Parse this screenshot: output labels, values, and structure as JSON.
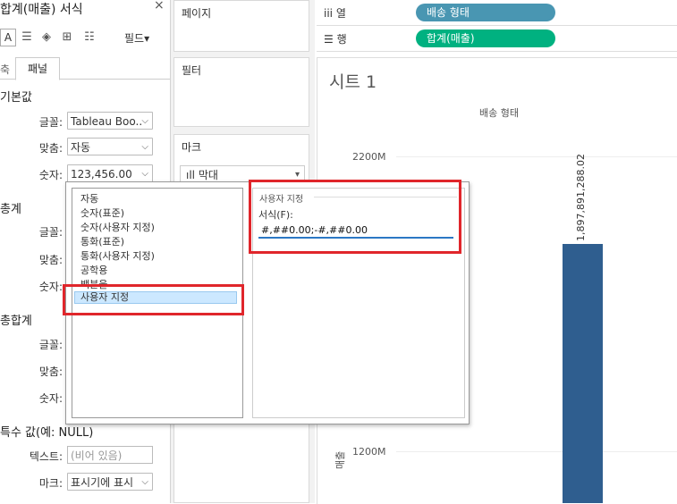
{
  "format_pane": {
    "title": "합계(매출) 서식",
    "close_glyph": "×",
    "fields_button": "필드▾",
    "tabs": {
      "inactive": "축",
      "active": "패널"
    },
    "sections": {
      "default": {
        "title": "기본값",
        "font_label": "글꼴:",
        "font_value": "Tableau Boo..",
        "align_label": "맞춤:",
        "align_value": "자동",
        "number_label": "숫자:",
        "number_value": "123,456.00"
      },
      "totals": {
        "title": "총계",
        "font_label": "글꼴:",
        "align_label": "맞춤:",
        "number_label": "숫자:"
      },
      "grand_totals": {
        "title": "총합계",
        "font_label": "글꼴:",
        "align_label": "맞춤:",
        "number_label": "숫자:"
      },
      "special": {
        "title": "특수 값(예: NULL)",
        "text_label": "텍스트:",
        "text_placeholder": "(비어 있음)",
        "marks_label": "마크:",
        "marks_value": "표시기에 표시"
      }
    }
  },
  "cards": {
    "pages": "페이지",
    "filters": "필터",
    "marks": "마크",
    "mark_type": "막대"
  },
  "shelves": {
    "columns": {
      "label": "열",
      "pill": "배송 형태",
      "color": "#4996b2"
    },
    "rows": {
      "label": "행",
      "pill": "합계(매출)",
      "color": "#00b180"
    }
  },
  "view": {
    "sheet_title": "시트 1",
    "column_header": "배송 형태",
    "axis_title": "매출",
    "axis_ticks": [
      "2200M",
      "1200M"
    ],
    "bar_label": "1,897,891,288.02",
    "bar_color": "#2f5e8f"
  },
  "number_format_popup": {
    "options": [
      "자동",
      "숫자(표준)",
      "숫자(사용자 지정)",
      "통화(표준)",
      "통화(사용자 지정)",
      "공학용",
      "백분율",
      "사용자 지정"
    ],
    "selected_index": 7,
    "custom_group_title": "사용자 지정",
    "format_label": "서식(F):",
    "format_value": "#,##0.00;-#,##0.00"
  }
}
